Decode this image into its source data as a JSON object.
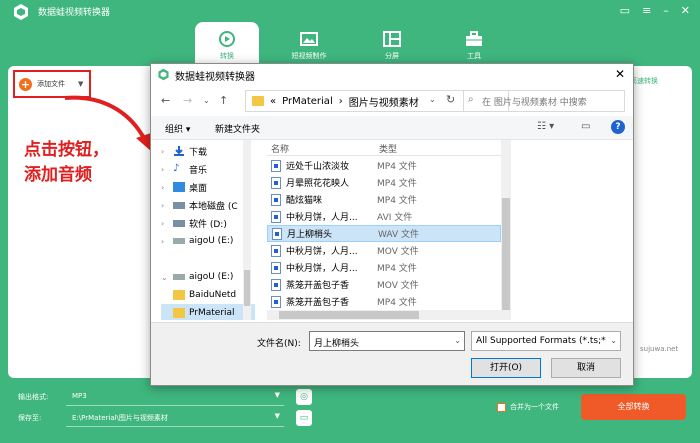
{
  "app": {
    "title": "数据蛙视频转换器",
    "nav_tabs": [
      {
        "label": "转换",
        "icon": "convert-icon",
        "active": true
      },
      {
        "label": "短视频制作",
        "icon": "image-icon",
        "active": false
      },
      {
        "label": "分屏",
        "icon": "split-screen-icon",
        "active": false
      },
      {
        "label": "工具",
        "icon": "toolbox-icon",
        "active": false
      }
    ],
    "add_file_label": "添加文件",
    "merge_convert_label": "高速转换",
    "watermark": "sujuwa.net",
    "annotation_line1": "点击按钮，",
    "annotation_line2": "添加音频",
    "output_format_label": "输出格式:",
    "output_format_value": "MP3",
    "save_to_label": "保存至:",
    "save_to_value": "E:\\PrMaterial\\图片与视频素材",
    "merge_label": "合并为一个文件",
    "convert_all_label": "全部转换",
    "accent": "#3fb67e",
    "orange": "#f05a28"
  },
  "dialog": {
    "title": "数据蛙视频转换器",
    "breadcrumb_prefix": "«",
    "breadcrumb": [
      "PrMaterial",
      "›",
      "图片与视频素材"
    ],
    "search_placeholder": "在 图片与视频素材 中搜索",
    "organize_label": "组织 ▾",
    "new_folder_label": "新建文件夹",
    "tree": [
      {
        "label": "下载",
        "icon": "download-icon",
        "chev": "›"
      },
      {
        "label": "音乐",
        "icon": "music-icon",
        "chev": "›"
      },
      {
        "label": "桌面",
        "icon": "desktop-icon",
        "chev": "›"
      },
      {
        "label": "本地磁盘 (C",
        "icon": "drive-icon",
        "chev": "›"
      },
      {
        "label": "软件 (D:)",
        "icon": "drive-icon",
        "chev": "›"
      },
      {
        "label": "aigoU (E:)",
        "icon": "usb-drive-icon",
        "chev": "›"
      },
      {
        "label": "",
        "icon": "",
        "chev": ""
      },
      {
        "label": "aigoU (E:)",
        "icon": "usb-drive-icon",
        "chev": "⌄"
      },
      {
        "label": "BaiduNetd",
        "icon": "folder-icon",
        "chev": "›"
      },
      {
        "label": "PrMaterial",
        "icon": "folder-icon",
        "chev": "›",
        "selected": true
      }
    ],
    "column_name": "名称",
    "column_type": "类型",
    "files": [
      {
        "name": "远处千山浓淡妆",
        "type": "MP4 文件"
      },
      {
        "name": "月晕照花花映人",
        "type": "MP4 文件"
      },
      {
        "name": "酷炫猫咪",
        "type": "MP4 文件"
      },
      {
        "name": "中秋月饼，人月...",
        "type": "AVI 文件"
      },
      {
        "name": "月上柳梢头",
        "type": "WAV 文件",
        "selected": true
      },
      {
        "name": "中秋月饼，人月...",
        "type": "MOV 文件"
      },
      {
        "name": "中秋月饼，人月...",
        "type": "MP4 文件"
      },
      {
        "name": "蒸笼开盖包子香",
        "type": "MOV 文件"
      },
      {
        "name": "蒸笼开盖包子香",
        "type": "MP4 文件"
      }
    ],
    "filename_label": "文件名(N):",
    "filename_value": "月上柳梢头",
    "filetype_value": "All Supported Formats (*.ts;*",
    "open_label": "打开(O)",
    "cancel_label": "取消"
  }
}
